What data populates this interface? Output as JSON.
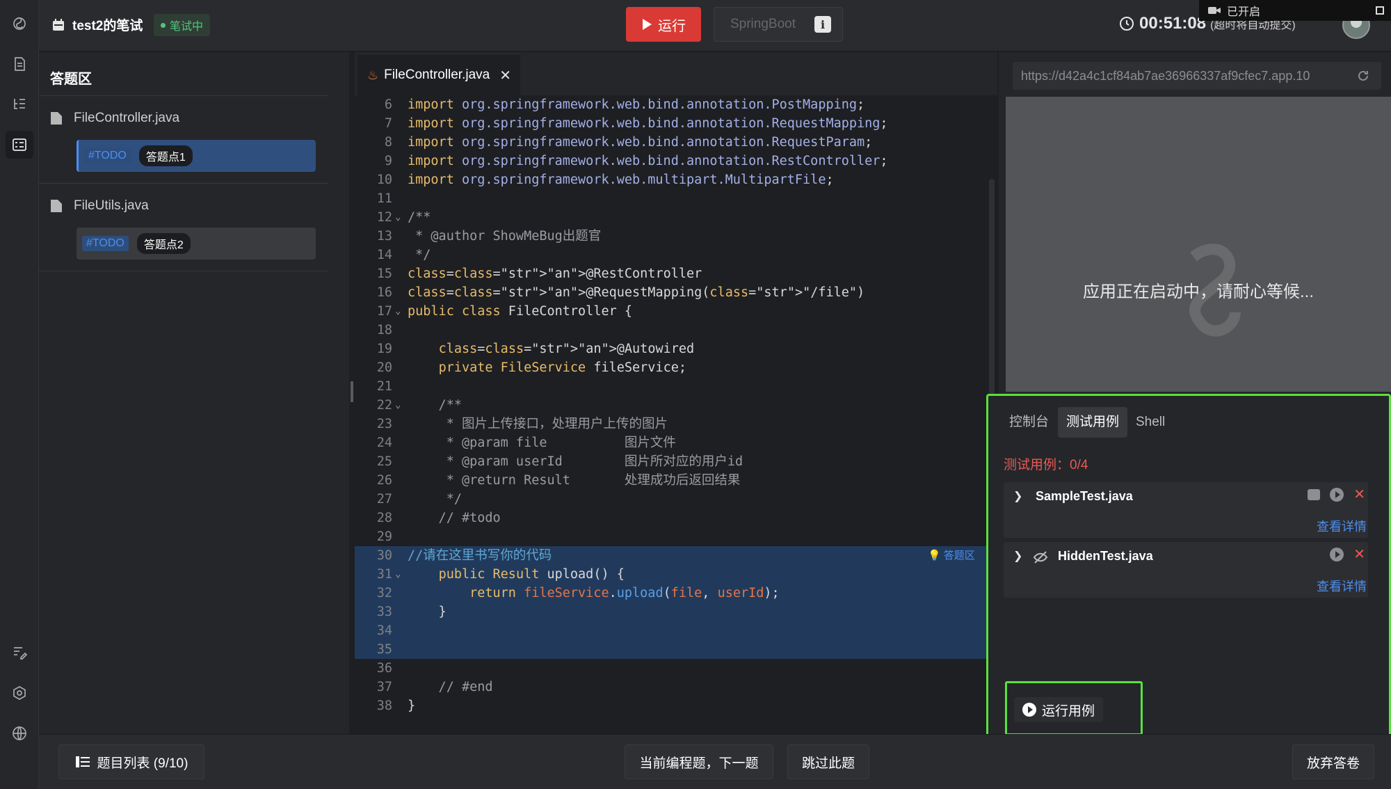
{
  "topbar": {
    "exam_title": "test2的笔试",
    "exam_status": "笔试中",
    "run_label": "运行",
    "env_label": "SpringBoot",
    "env_info": "i",
    "timer_value": "00:51:08",
    "timer_note": "(超时将自动提交)",
    "recording_label": "已开启"
  },
  "answer_panel": {
    "title": "答题区",
    "files": [
      {
        "name": "FileController.java",
        "todo": "#TODO",
        "point": "答题点1"
      },
      {
        "name": "FileUtils.java",
        "todo": "#TODO",
        "point": "答题点2"
      }
    ]
  },
  "editor": {
    "tab_label": "FileController.java",
    "tab_close": "✕",
    "answer_flag": "答题区",
    "lines": [
      {
        "n": "6",
        "fold": "",
        "t": "import org.springframework.web.bind.annotation.PostMapping;"
      },
      {
        "n": "7",
        "fold": "",
        "t": "import org.springframework.web.bind.annotation.RequestMapping;"
      },
      {
        "n": "8",
        "fold": "",
        "t": "import org.springframework.web.bind.annotation.RequestParam;"
      },
      {
        "n": "9",
        "fold": "",
        "t": "import org.springframework.web.bind.annotation.RestController;"
      },
      {
        "n": "10",
        "fold": "",
        "t": "import org.springframework.web.multipart.MultipartFile;"
      },
      {
        "n": "11",
        "fold": "",
        "t": ""
      },
      {
        "n": "12",
        "fold": "⌄",
        "t": "/**"
      },
      {
        "n": "13",
        "fold": "",
        "t": " * @author ShowMeBug出题官"
      },
      {
        "n": "14",
        "fold": "",
        "t": " */"
      },
      {
        "n": "15",
        "fold": "",
        "t": "@RestController"
      },
      {
        "n": "16",
        "fold": "",
        "t": "@RequestMapping(\"/file\")"
      },
      {
        "n": "17",
        "fold": "⌄",
        "t": "public class FileController {"
      },
      {
        "n": "18",
        "fold": "",
        "t": ""
      },
      {
        "n": "19",
        "fold": "",
        "t": "    @Autowired"
      },
      {
        "n": "20",
        "fold": "",
        "t": "    private FileService fileService;"
      },
      {
        "n": "21",
        "fold": "",
        "t": ""
      },
      {
        "n": "22",
        "fold": "⌄",
        "t": "    /**"
      },
      {
        "n": "23",
        "fold": "",
        "t": "     * 图片上传接口，处理用户上传的图片"
      },
      {
        "n": "24",
        "fold": "",
        "t": "     * @param file          图片文件"
      },
      {
        "n": "25",
        "fold": "",
        "t": "     * @param userId        图片所对应的用户id"
      },
      {
        "n": "26",
        "fold": "",
        "t": "     * @return Result       处理成功后返回结果"
      },
      {
        "n": "27",
        "fold": "",
        "t": "     */"
      },
      {
        "n": "28",
        "fold": "",
        "t": "    // #todo"
      },
      {
        "n": "29",
        "fold": "",
        "t": ""
      },
      {
        "n": "30",
        "fold": "",
        "t": "//请在这里书写你的代码"
      },
      {
        "n": "31",
        "fold": "⌄",
        "t": "    public Result upload() {"
      },
      {
        "n": "32",
        "fold": "",
        "t": "        return fileService.upload(file, userId);"
      },
      {
        "n": "33",
        "fold": "",
        "t": "    }"
      },
      {
        "n": "34",
        "fold": "",
        "t": ""
      },
      {
        "n": "35",
        "fold": "",
        "t": ""
      },
      {
        "n": "36",
        "fold": "",
        "t": ""
      },
      {
        "n": "37",
        "fold": "",
        "t": "    // #end"
      },
      {
        "n": "38",
        "fold": "",
        "t": "}"
      }
    ]
  },
  "preview": {
    "url": "https://d42a4c1cf84ab7ae36966337af9cfec7.app.10",
    "loading_text": "应用正在启动中，请耐心等候..."
  },
  "tests": {
    "tabs": [
      "控制台",
      "测试用例",
      "Shell"
    ],
    "count_label": "测试用例：0/4",
    "cases": [
      {
        "name": "SampleTest.java",
        "detail": "查看详情"
      },
      {
        "name": "HiddenTest.java",
        "detail": "查看详情"
      }
    ],
    "run_label": "运行用例"
  },
  "bottombar": {
    "list_label": "题目列表 (9/10)",
    "next_label": "当前编程题，下一题",
    "skip_label": "跳过此题",
    "abandon_label": "放弃答卷"
  },
  "colors": {
    "accent_red": "#d93a35",
    "highlight_green": "#57e33c",
    "link_blue": "#4c8ef0",
    "status_green": "#54c381"
  },
  "icons": [
    "logo-icon",
    "document-icon",
    "tree-icon",
    "checklist-icon",
    "edit-note-icon",
    "settings-hex-icon",
    "globe-icon",
    "calendar-icon",
    "play-icon",
    "clock-icon",
    "camera-icon",
    "file-icon",
    "java-icon",
    "reload-icon",
    "chevron-down-icon",
    "eye-off-icon",
    "list-icon"
  ]
}
